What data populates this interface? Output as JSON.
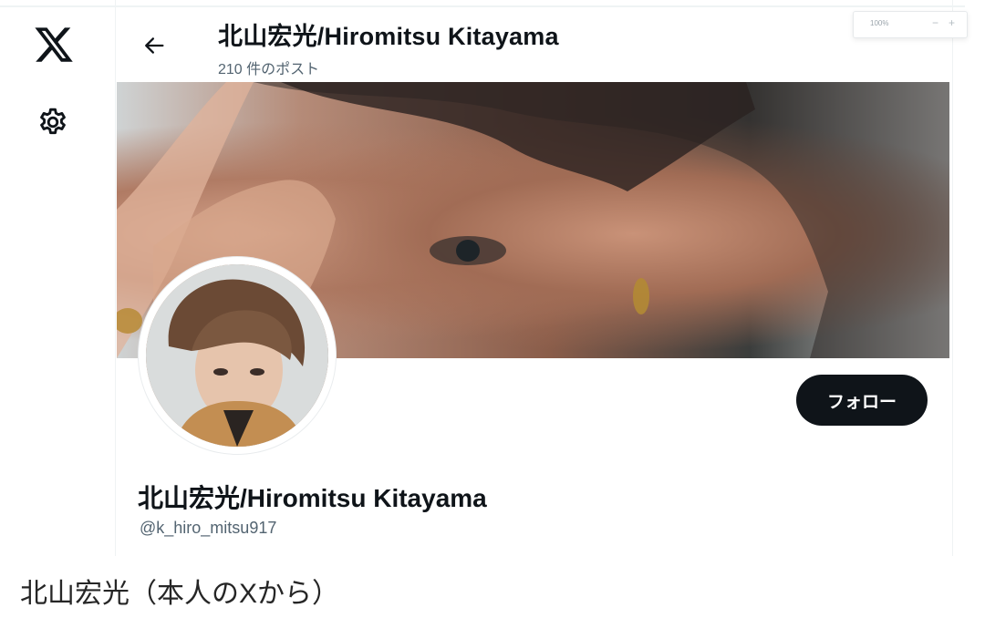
{
  "header": {
    "display_name": "北山宏光/Hiromitsu Kitayama",
    "post_count": "210 件のポスト"
  },
  "zoom": {
    "value": "100%",
    "minus": "−",
    "plus": "+"
  },
  "profile": {
    "display_name": "北山宏光/Hiromitsu Kitayama",
    "handle": "@k_hiro_mitsu917",
    "follow_label": "フォロー"
  },
  "caption": "北山宏光（本人のXから）",
  "icons": [
    "x-logo-icon",
    "gear-icon",
    "back-arrow-icon"
  ],
  "colors": {
    "follow_button_bg": "#0f1419",
    "secondary_text": "#536471",
    "border": "#eff3f4"
  }
}
